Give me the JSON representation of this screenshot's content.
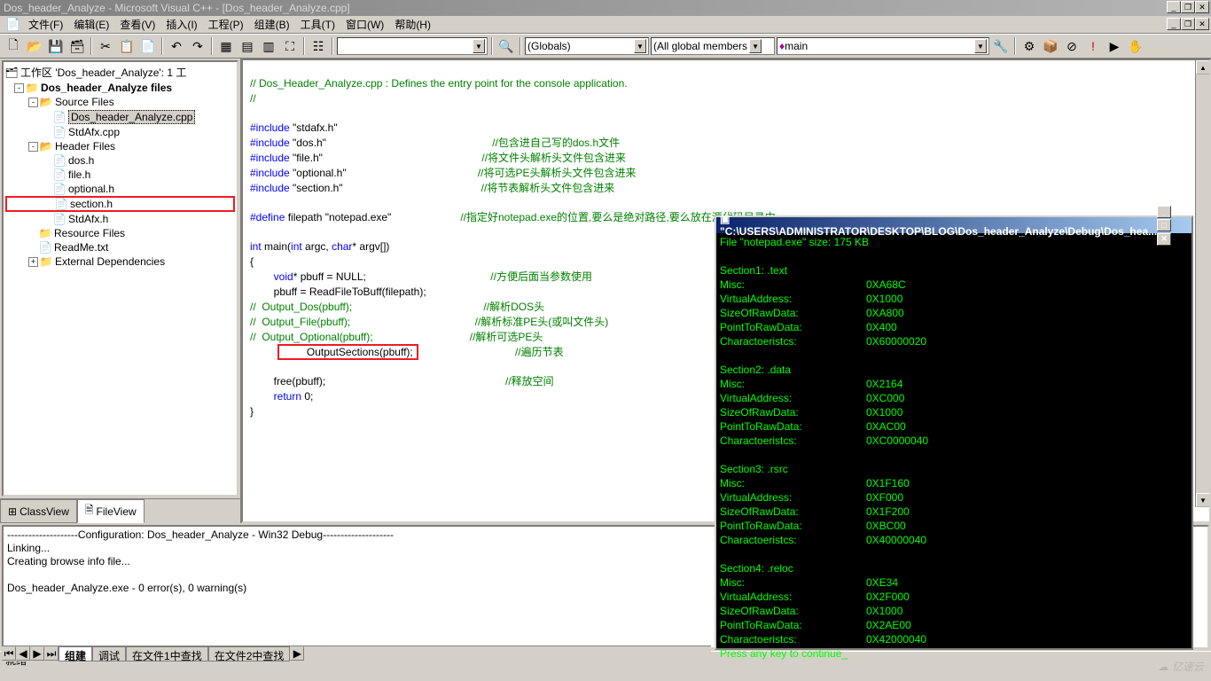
{
  "title": "Dos_header_Analyze - Microsoft Visual C++ - [Dos_header_Analyze.cpp]",
  "menus": {
    "file": "文件(F)",
    "edit": "编辑(E)",
    "view": "查看(V)",
    "insert": "插入(I)",
    "project": "工程(P)",
    "build": "组建(B)",
    "tools": "工具(T)",
    "window": "窗口(W)",
    "help": "帮助(H)"
  },
  "toolbar2": {
    "scope": "(Globals)",
    "members": "(All global members",
    "func": "main"
  },
  "workspace": {
    "root": "工作区 'Dos_header_Analyze': 1 工",
    "project": "Dos_header_Analyze files",
    "source_folder": "Source Files",
    "src1": "Dos_header_Analyze.cpp",
    "src2": "StdAfx.cpp",
    "header_folder": "Header Files",
    "h1": "dos.h",
    "h2": "file.h",
    "h3": "optional.h",
    "h4": "section.h",
    "h5": "StdAfx.h",
    "resource_folder": "Resource Files",
    "readme": "ReadMe.txt",
    "ext": "External Dependencies"
  },
  "tabs": {
    "classview": "ClassView",
    "fileview": "FileView"
  },
  "code": {
    "l1": "// Dos_Header_Analyze.cpp : Defines the entry point for the console application.",
    "l2": "//",
    "l3a": "#include ",
    "l3b": "\"stdafx.h\"",
    "l4a": "#include ",
    "l4b": "\"dos.h\"",
    "l4c": "//包含进自己写的dos.h文件",
    "l5a": "#include ",
    "l5b": "\"file.h\"",
    "l5c": "//将文件头解析头文件包含进来",
    "l6a": "#include ",
    "l6b": "\"optional.h\"",
    "l6c": "//将可选PE头解析头文件包含进来",
    "l7a": "#include ",
    "l7b": "\"section.h\"",
    "l7c": "//将节表解析头文件包含进来",
    "l8a": "#define ",
    "l8b": "filepath ",
    "l8c": "\"notepad.exe\"",
    "l8d": "//指定好notepad.exe的位置,要么是绝对路径,要么放在源代码目录中",
    "l9a": "int ",
    "l9b": "main(",
    "l9c": "int ",
    "l9d": "argc, ",
    "l9e": "char",
    "l9f": "* argv[])",
    "l10": "{",
    "l11a": "        void",
    "l11b": "* pbuff = NULL;",
    "l11c": "//方便后面当参数使用",
    "l12": "        pbuff = ReadFileToBuff(filepath);",
    "l13a": "//  Output_Dos(pbuff);",
    "l13b": "//解析DOS头",
    "l14a": "//  Output_File(pbuff);",
    "l14b": "//解析标准PE头(或叫文件头)",
    "l15a": "//  Output_Optional(pbuff);",
    "l15b": "//解析可选PE头",
    "l16a": "        OutputSections(pbuff);",
    "l16b": "//遍历节表",
    "l17": "        free(pbuff);",
    "l17b": "//释放空间",
    "l18a": "        return ",
    "l18b": "0;",
    "l19": "}"
  },
  "output": {
    "l1": "--------------------Configuration: Dos_header_Analyze - Win32 Debug--------------------",
    "l2": "Linking...",
    "l3": "Creating browse info file...",
    "l4": "",
    "l5": "Dos_header_Analyze.exe - 0 error(s), 0 warning(s)"
  },
  "output_tabs": {
    "build": "组建",
    "debug": "调试",
    "find1": "在文件1中查找",
    "find2": "在文件2中查找"
  },
  "status": "就绪",
  "console": {
    "title": "\"C:\\USERS\\ADMINISTRATOR\\DESKTOP\\BLOG\\Dos_header_Analyze\\Debug\\Dos_hea...",
    "header": "File \"notepad.exe\" size: 175 KB",
    "sections": [
      {
        "name": "Section1: .text",
        "misc": "0XA68C",
        "va": "0X1000",
        "srd": "0XA800",
        "prd": "0X400",
        "chr": "0X60000020"
      },
      {
        "name": "Section2: .data",
        "misc": "0X2164",
        "va": "0XC000",
        "srd": "0X1000",
        "prd": "0XAC00",
        "chr": "0XC0000040"
      },
      {
        "name": "Section3: .rsrc",
        "misc": "0X1F160",
        "va": "0XF000",
        "srd": "0X1F200",
        "prd": "0XBC00",
        "chr": "0X40000040"
      },
      {
        "name": "Section4: .reloc",
        "misc": "0XE34",
        "va": "0X2F000",
        "srd": "0X1000",
        "prd": "0X2AE00",
        "chr": "0X42000040"
      }
    ],
    "labels": {
      "misc": "Misc:",
      "va": "VirtualAddress:",
      "srd": "SizeOfRawData:",
      "prd": "PointToRawData:",
      "chr": "Charactoeristcs:"
    },
    "footer": "Press any key to continue_"
  },
  "watermark": "亿速云"
}
